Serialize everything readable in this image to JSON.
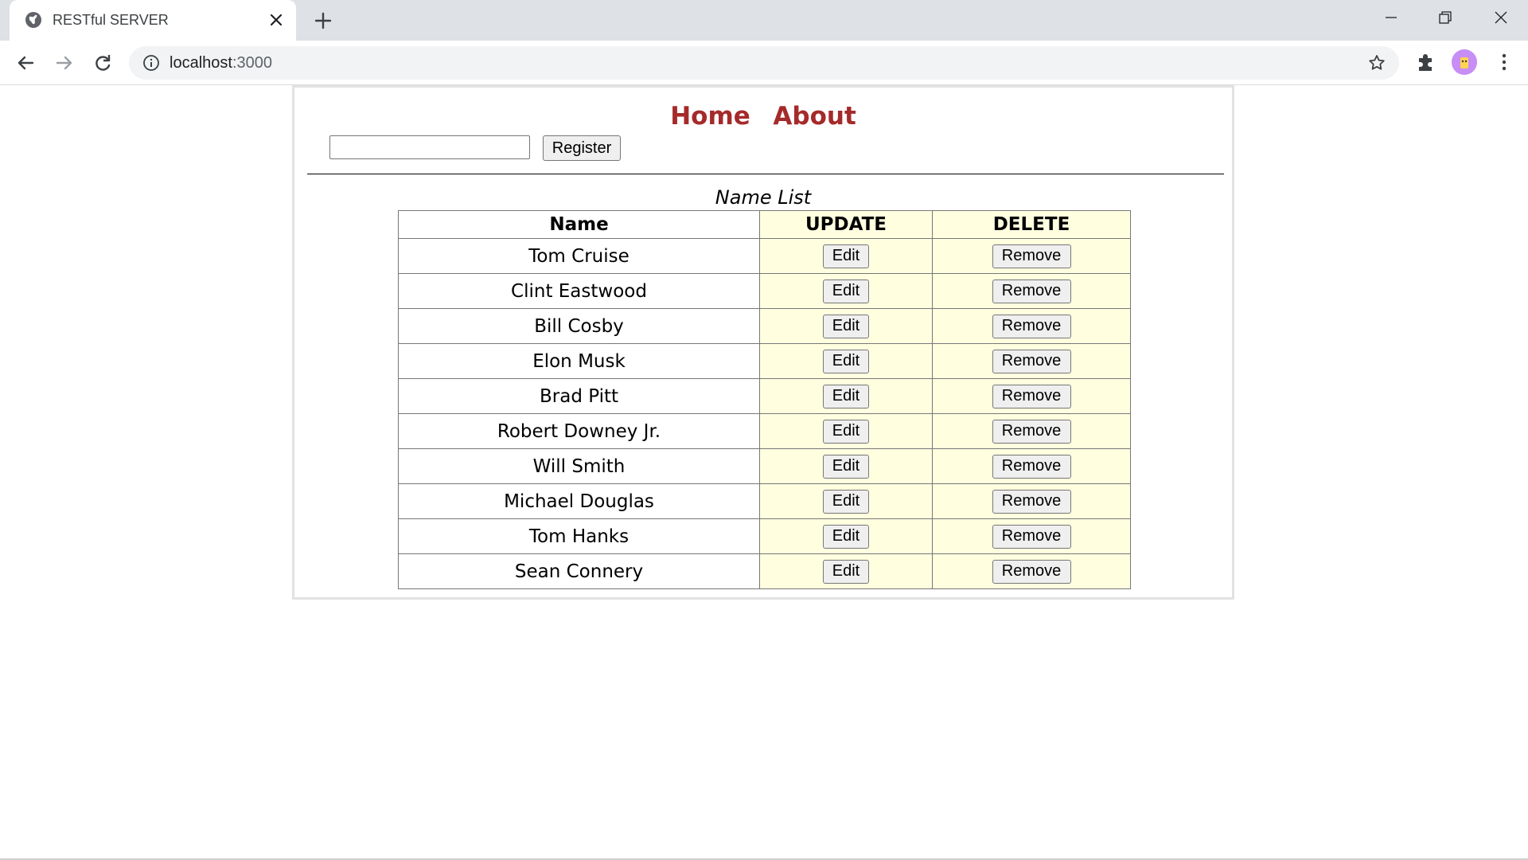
{
  "browser": {
    "tab_title": "RESTful SERVER",
    "url_host": "localhost",
    "url_port": ":3000"
  },
  "nav": {
    "home": "Home",
    "about": "About"
  },
  "form": {
    "input_value": "",
    "register_label": "Register"
  },
  "table": {
    "caption": "Name List",
    "headers": [
      "Name",
      "UPDATE",
      "DELETE"
    ],
    "edit_label": "Edit",
    "remove_label": "Remove",
    "rows": [
      "Tom Cruise",
      "Clint Eastwood",
      "Bill Cosby",
      "Elon Musk",
      "Brad Pitt",
      "Robert Downey Jr.",
      "Will Smith",
      "Michael Douglas",
      "Tom Hanks",
      "Sean Connery"
    ]
  },
  "colors": {
    "nav_link": "#a52a2a",
    "action_cell_bg": "#ffffe0"
  }
}
